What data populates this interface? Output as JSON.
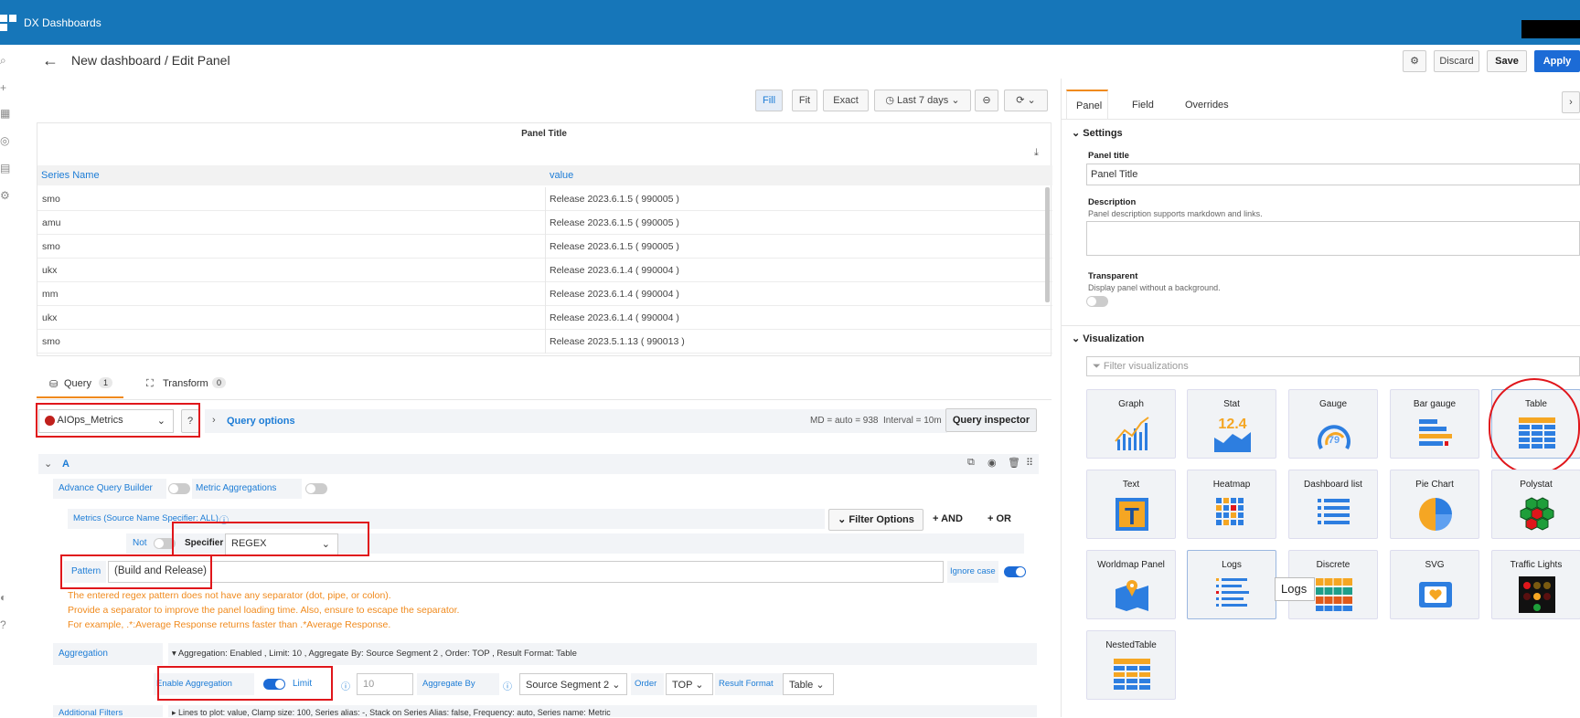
{
  "app_title": "DX Dashboards",
  "header": {
    "breadcrumb": "New dashboard / Edit Panel",
    "discard_label": "Discard",
    "save_label": "Save",
    "apply_label": "Apply"
  },
  "time_controls": {
    "fill": "Fill",
    "fit": "Fit",
    "exact": "Exact",
    "range": "Last 7 days"
  },
  "panel_preview": {
    "title": "Panel Title",
    "columns": [
      "Series Name",
      "value"
    ],
    "rows": [
      [
        "smo",
        "Release 2023.6.1.5 ( 990005 )"
      ],
      [
        "amu",
        "Release 2023.6.1.5 ( 990005 )"
      ],
      [
        "smo",
        "Release 2023.6.1.5 ( 990005 )"
      ],
      [
        "ukx",
        "Release 2023.6.1.4 ( 990004 )"
      ],
      [
        "mm",
        "Release 2023.6.1.4 ( 990004 )"
      ],
      [
        "ukx",
        "Release 2023.6.1.4 ( 990004 )"
      ],
      [
        "smo",
        "Release 2023.5.1.13 ( 990013 )"
      ]
    ]
  },
  "query_tabs": {
    "query_label": "Query",
    "query_count": "1",
    "transform_label": "Transform",
    "transform_count": "0"
  },
  "datasource": {
    "name": "AIOps_Metrics",
    "query_options": "Query options",
    "md_info": "MD = auto = 938",
    "interval_info": "Interval = 10m",
    "inspector_label": "Query inspector"
  },
  "query_a": {
    "letter": "A",
    "advance_builder": "Advance Query Builder",
    "metric_aggregations": "Metric Aggregations",
    "metrics_label": "Metrics (Source Name Specifier: ALL)",
    "filter_options": "Filter Options",
    "and_label": "AND",
    "or_label": "OR",
    "not_label": "Not",
    "specifier_label": "Specifier",
    "specifier_value": "REGEX",
    "pattern_label": "Pattern",
    "pattern_value": "(Build and Release)",
    "ignore_case": "Ignore case",
    "warnings": [
      "The entered regex pattern does not have any separator (dot, pipe, or colon).",
      "Provide a separator to improve the panel loading time. Also, ensure to escape the separator.",
      "For example, .*:Average Response returns faster than .*Average Response."
    ],
    "aggregation_label": "Aggregation",
    "aggregation_summary": "Aggregation: Enabled , Limit: 10 , Aggregate By: Source Segment 2 , Order: TOP , Result Format: Table",
    "enable_aggregation": "Enable Aggregation",
    "limit_label": "Limit",
    "limit_value": "10",
    "aggregate_by_label": "Aggregate By",
    "aggregate_by_value": "Source Segment 2",
    "order_label": "Order",
    "order_value": "TOP",
    "result_format_label": "Result Format",
    "result_format_value": "Table",
    "additional_filters": "Additional Filters",
    "lines_summary": "Lines to plot: value, Clamp size: 100, Series alias: -, Stack on Series Alias: false, Frequency: auto, Series name: Metric"
  },
  "right_panel": {
    "tabs": [
      "Panel",
      "Field",
      "Overrides"
    ],
    "settings_label": "Settings",
    "panel_title_label": "Panel title",
    "panel_title_value": "Panel Title",
    "description_label": "Description",
    "description_hint": "Panel description supports markdown and links.",
    "transparent_label": "Transparent",
    "transparent_hint": "Display panel without a background.",
    "visualization_label": "Visualization",
    "filter_placeholder": "Filter visualizations",
    "tooltip": "Logs",
    "visualizations": [
      "Graph",
      "Stat",
      "Gauge",
      "Bar gauge",
      "Table",
      "Text",
      "Heatmap",
      "Dashboard list",
      "Pie Chart",
      "Polystat",
      "Worldmap Panel",
      "Logs",
      "Discrete",
      "SVG",
      "Traffic Lights",
      "NestedTable"
    ],
    "stat_value": "12.4",
    "gauge_value": "79"
  },
  "colors": {
    "topbar": "#1676b9",
    "accent": "#1c6bd6",
    "warning": "#f08a1d",
    "highlight": "#e0161b"
  }
}
